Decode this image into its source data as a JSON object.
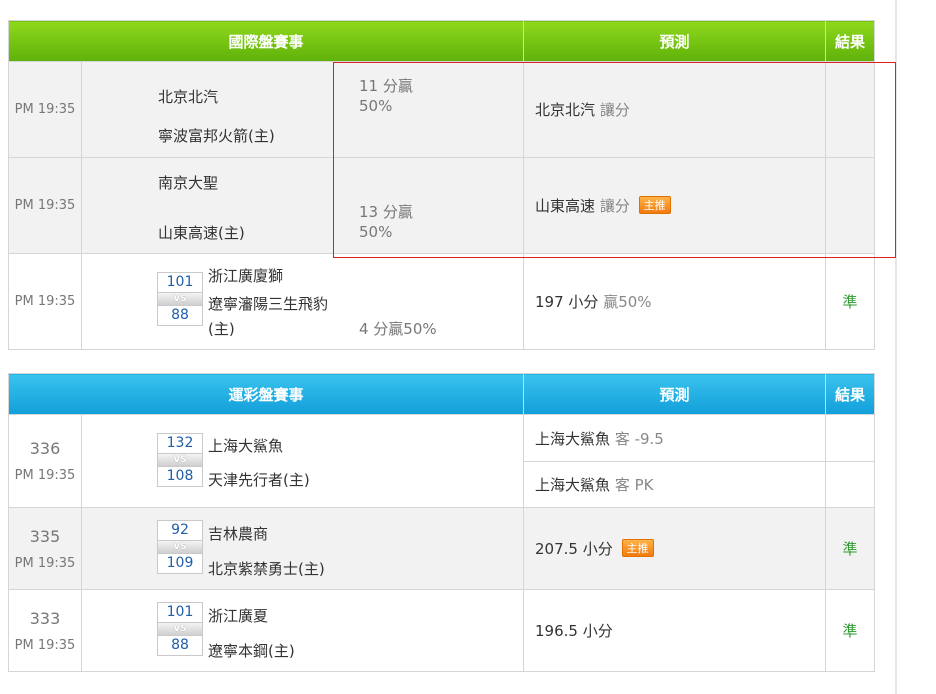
{
  "intl_section": {
    "header": {
      "match_title": "國際盤賽事",
      "prediction_title": "預測",
      "result_title": "結果"
    },
    "rows": [
      {
        "time": "PM 19:35",
        "team_a": "北京北汽",
        "team_b": "寧波富邦火箭(主)",
        "spread_line1": "11 分贏",
        "spread_line2": "50%",
        "pred_team": "北京北汽",
        "pred_type": "讓分",
        "result": ""
      },
      {
        "time": "PM 19:35",
        "team_a": "南京大聖",
        "team_b": "山東高速(主)",
        "spread_line1": "13 分贏",
        "spread_line2": "50%",
        "pred_team": "山東高速",
        "pred_type": "讓分",
        "badge": "主推",
        "result": ""
      },
      {
        "time": "PM 19:35",
        "score_a": "101",
        "score_b": "88",
        "vs": "VS",
        "team_a": "浙江廣廈獅",
        "team_b_line1": "遼寧瀋陽三生飛豹",
        "team_b_line2": "(主)",
        "spread": "4 分贏50%",
        "pred_main": "197 小分",
        "pred_extra": "贏50%",
        "result": "準"
      }
    ]
  },
  "lottery_section": {
    "header": {
      "match_title": "運彩盤賽事",
      "prediction_title": "預測",
      "result_title": "結果"
    },
    "rows": [
      {
        "num": "336",
        "time": "PM 19:35",
        "score_a": "132",
        "score_b": "108",
        "vs": "VS",
        "team_a": "上海大鯊魚",
        "team_b": "天津先行者(主)",
        "pred1_team": "上海大鯊魚",
        "pred1_type": "客 -9.5",
        "pred2_team": "上海大鯊魚",
        "pred2_type": "客 PK",
        "result1": "",
        "result2": ""
      },
      {
        "num": "335",
        "time": "PM 19:35",
        "score_a": "92",
        "score_b": "109",
        "vs": "VS",
        "team_a": "吉林農商",
        "team_b": "北京紫禁勇士(主)",
        "pred": "207.5 小分",
        "badge": "主推",
        "result": "準"
      },
      {
        "num": "333",
        "time": "PM 19:35",
        "score_a": "101",
        "score_b": "88",
        "vs": "VS",
        "team_a": "浙江廣夏",
        "team_b": "遼寧本鋼(主)",
        "pred": "196.5 小分",
        "result": "準"
      }
    ]
  },
  "colors": {
    "intl_header": "#6cc40f",
    "lottery_header": "#1fabe3",
    "result_text": "#2f9a2f",
    "highlight_border": "#e02020",
    "badge": "#f08a1c"
  }
}
